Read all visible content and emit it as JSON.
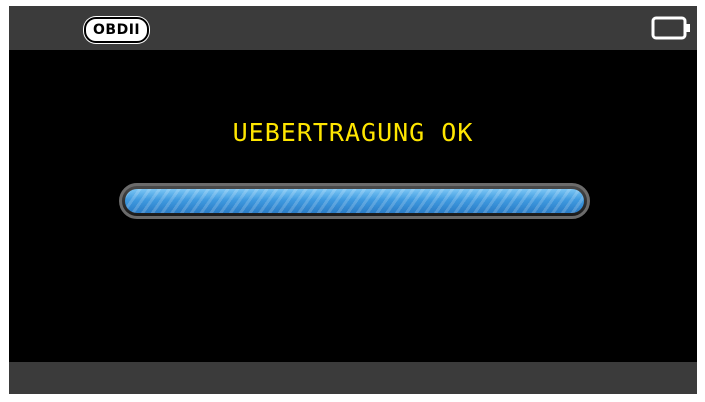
{
  "header": {
    "badge_label": "OBDII",
    "battery_icon": "battery-icon"
  },
  "main": {
    "status_message": "UEBERTRAGUNG OK",
    "progress_fraction": 1.0
  },
  "colors": {
    "message_text": "#ffe600",
    "progress_fill": "#3f9ae0",
    "bars": "#3b3b3b",
    "screen_background": "#000000"
  }
}
